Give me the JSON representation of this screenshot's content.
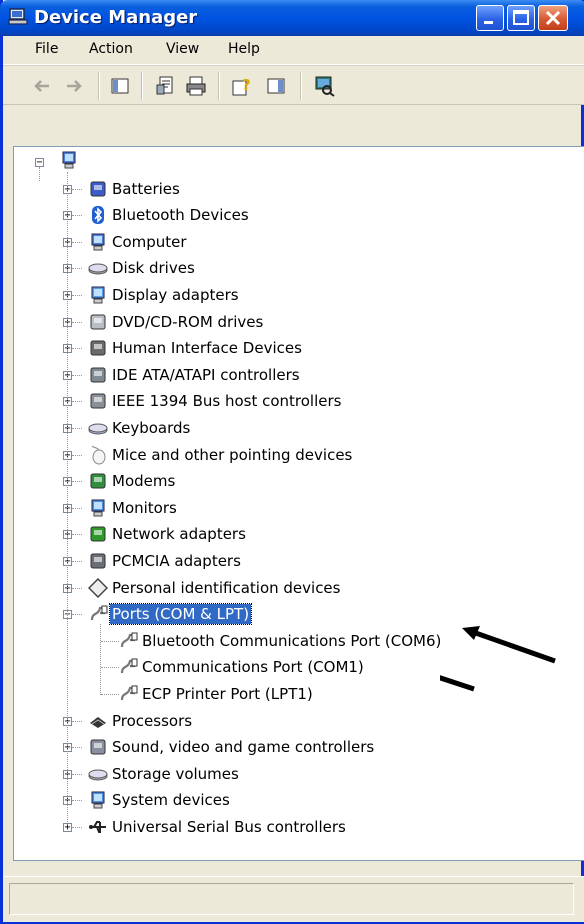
{
  "window": {
    "title": "Device Manager"
  },
  "menu": [
    "File",
    "Action",
    "View",
    "Help"
  ],
  "tree": {
    "root_icon": "computer-icon",
    "categories": [
      {
        "label": "Batteries",
        "icon": "battery-icon",
        "expanded": false
      },
      {
        "label": "Bluetooth Devices",
        "icon": "bluetooth-icon",
        "expanded": false
      },
      {
        "label": "Computer",
        "icon": "computer-icon",
        "expanded": false
      },
      {
        "label": "Disk drives",
        "icon": "disk-drive-icon",
        "expanded": false
      },
      {
        "label": "Display adapters",
        "icon": "display-adapter-icon",
        "expanded": false
      },
      {
        "label": "DVD/CD-ROM drives",
        "icon": "dvd-drive-icon",
        "expanded": false
      },
      {
        "label": "Human Interface Devices",
        "icon": "hid-icon",
        "expanded": false
      },
      {
        "label": "IDE ATA/ATAPI controllers",
        "icon": "ide-controller-icon",
        "expanded": false
      },
      {
        "label": "IEEE 1394 Bus host controllers",
        "icon": "ieee1394-icon",
        "expanded": false
      },
      {
        "label": "Keyboards",
        "icon": "keyboard-icon",
        "expanded": false
      },
      {
        "label": "Mice and other pointing devices",
        "icon": "mouse-icon",
        "expanded": false
      },
      {
        "label": "Modems",
        "icon": "modem-icon",
        "expanded": false
      },
      {
        "label": "Monitors",
        "icon": "monitor-icon",
        "expanded": false
      },
      {
        "label": "Network adapters",
        "icon": "network-adapter-icon",
        "expanded": false
      },
      {
        "label": "PCMCIA adapters",
        "icon": "pcmcia-icon",
        "expanded": false
      },
      {
        "label": "Personal identification devices",
        "icon": "identification-icon",
        "expanded": false
      },
      {
        "label": "Ports (COM & LPT)",
        "icon": "port-icon",
        "expanded": true,
        "selected": true,
        "children": [
          {
            "label": "Bluetooth Communications Port (COM6)",
            "icon": "port-icon"
          },
          {
            "label": "Communications Port (COM1)",
            "icon": "port-icon"
          },
          {
            "label": "ECP Printer Port (LPT1)",
            "icon": "port-icon"
          }
        ]
      },
      {
        "label": "Processors",
        "icon": "processor-icon",
        "expanded": false
      },
      {
        "label": "Sound, video and game controllers",
        "icon": "sound-icon",
        "expanded": false
      },
      {
        "label": "Storage volumes",
        "icon": "storage-volume-icon",
        "expanded": false
      },
      {
        "label": "System devices",
        "icon": "system-device-icon",
        "expanded": false
      },
      {
        "label": "Universal Serial Bus controllers",
        "icon": "usb-icon",
        "expanded": false
      }
    ]
  },
  "colors": {
    "titlebar": "#0054e3",
    "selection": "#316ac5",
    "window_bg": "#ece9d8"
  }
}
